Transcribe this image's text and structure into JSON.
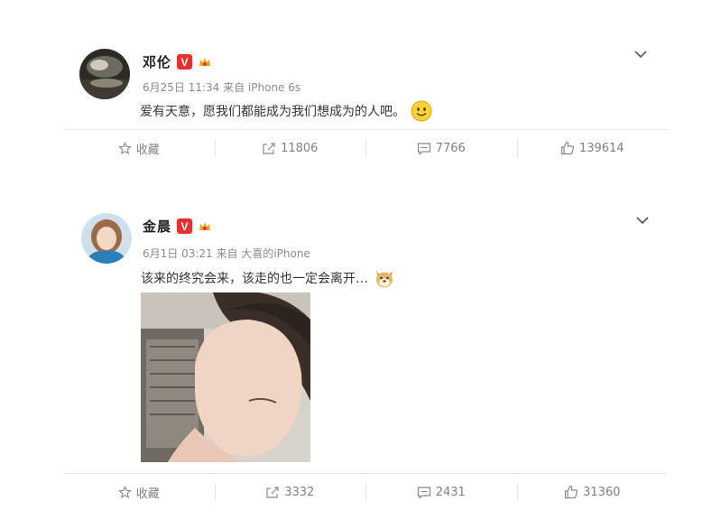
{
  "posts": [
    {
      "name": "邓伦",
      "verified_badge": "V",
      "meta": "6月25日 11:34 来自 iPhone 6s",
      "content": "爱有天意，愿我们都能成为我们想成为的人吧。",
      "content_emoji": "smile-emoji-icon",
      "actions": {
        "favorite": "收藏",
        "repost": "11806",
        "comment": "7766",
        "like": "139614"
      }
    },
    {
      "name": "金晨",
      "verified_badge": "V",
      "meta": "6月1日 03:21 来自 大喜的iPhone",
      "content": "该来的终究会来，该走的也一定会离开…",
      "content_emoji": "doge-emoji-icon",
      "actions": {
        "favorite": "收藏",
        "repost": "3332",
        "comment": "2431",
        "like": "31360"
      }
    }
  ],
  "colors": {
    "verified": "#e8302e",
    "meta_text": "#8a8a8a",
    "action_text": "#808080",
    "divider": "#e9e9e9"
  }
}
